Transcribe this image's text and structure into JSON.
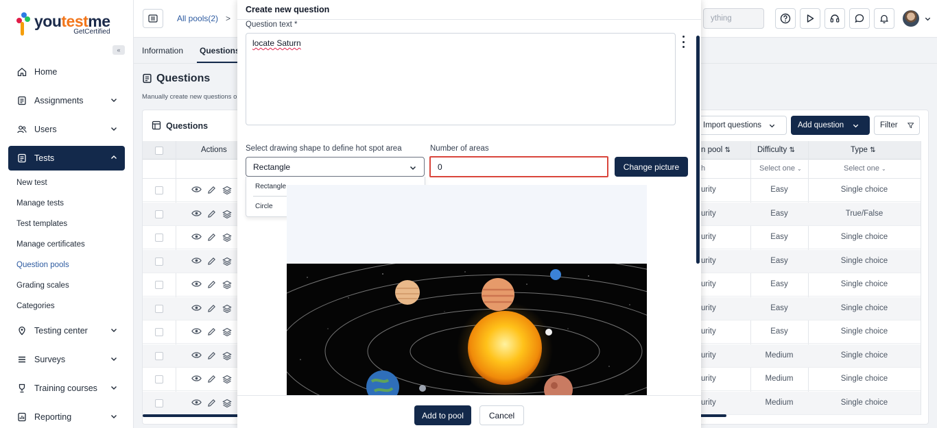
{
  "brand": {
    "word_you": "you",
    "word_test": "test",
    "word_me": "me",
    "sub": "GetCertified"
  },
  "sidebar": {
    "collapse_icon": "double-chevron-left-icon",
    "items": [
      {
        "label": "Home",
        "icon": "home-icon"
      },
      {
        "label": "Assignments",
        "icon": "assignments-icon"
      },
      {
        "label": "Users",
        "icon": "users-icon"
      },
      {
        "label": "Tests",
        "icon": "tests-icon"
      },
      {
        "label": "Testing center",
        "icon": "testing-center-icon"
      },
      {
        "label": "Surveys",
        "icon": "surveys-icon"
      },
      {
        "label": "Training courses",
        "icon": "training-courses-icon"
      },
      {
        "label": "Reporting",
        "icon": "reporting-icon"
      }
    ],
    "sub_items": [
      "New test",
      "Manage tests",
      "Test templates",
      "Manage certificates",
      "Question pools",
      "Grading scales",
      "Categories"
    ],
    "active_item": "Tests",
    "active_sub_item": "Question pools"
  },
  "topbar": {
    "breadcrumb": "All pools(2)",
    "breadcrumb_sep": ">",
    "search_placeholder": "ything"
  },
  "page": {
    "tabs": [
      "Information",
      "Questions"
    ],
    "active_tab": "Questions",
    "title": "Questions",
    "description": "Manually create new questions o",
    "card_title": "Questions",
    "import_label": "Import questions",
    "add_question_label": "Add question",
    "filter_label": "Filter"
  },
  "table": {
    "headers": {
      "actions": "Actions",
      "pool": "n pool",
      "difficulty": "Difficulty",
      "type": "Type"
    },
    "filters": {
      "pool": "h",
      "difficulty": "Select one",
      "type": "Select one"
    },
    "rows": [
      {
        "pool": "urity",
        "difficulty": "Easy",
        "type": "Single choice"
      },
      {
        "pool": "urity",
        "difficulty": "Easy",
        "type": "True/False"
      },
      {
        "pool": "urity",
        "difficulty": "Easy",
        "type": "Single choice"
      },
      {
        "pool": "urity",
        "difficulty": "Easy",
        "type": "Single choice"
      },
      {
        "pool": "urity",
        "difficulty": "Easy",
        "type": "Single choice"
      },
      {
        "pool": "urity",
        "difficulty": "Easy",
        "type": "Single choice"
      },
      {
        "pool": "urity",
        "difficulty": "Easy",
        "type": "Single choice"
      },
      {
        "pool": "urity",
        "difficulty": "Medium",
        "type": "Single choice"
      },
      {
        "pool": "urity",
        "difficulty": "Medium",
        "type": "Single choice"
      },
      {
        "pool": "urity",
        "difficulty": "Medium",
        "type": "Single choice"
      }
    ]
  },
  "modal": {
    "title": "Create new question",
    "question_label": "Question text *",
    "question_value": "locate Saturn",
    "shape_label": "Select drawing shape to define hot spot area",
    "shape_value": "Rectangle",
    "shape_options": [
      "Rectangle",
      "Circle"
    ],
    "areas_label": "Number of areas",
    "areas_value": "0",
    "change_picture": "Change picture",
    "add_to_pool": "Add to pool",
    "cancel": "Cancel"
  },
  "colors": {
    "navy": "#13294b",
    "accent_orange": "#f2761b",
    "error_red": "#d9453b",
    "link_blue": "#2c5aa0"
  }
}
